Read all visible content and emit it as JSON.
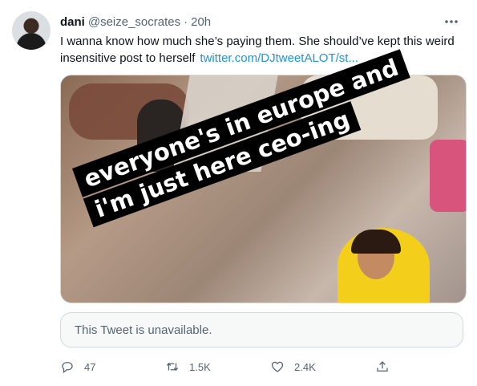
{
  "tweet": {
    "author_name": "dani",
    "author_handle": "@seize_socrates",
    "separator": "·",
    "time": "20h",
    "more_label": "•••",
    "text": "I wanna know how much she’s paying them. She should’ve kept this weird insensitive post to herself",
    "link_text": "twitter.com/DJtweetALOT/st...",
    "media": {
      "caption_lines": [
        "everyone's in europe and",
        "i'm just here ceo-ing"
      ]
    },
    "quoted": {
      "unavailable_text": "This Tweet is unavailable."
    },
    "actions": {
      "replies": "47",
      "retweets": "1.5K",
      "likes": "2.4K"
    }
  },
  "colors": {
    "text": "#0f1419",
    "secondary": "#536471",
    "link": "#1b95e0",
    "border": "#cfd9de"
  }
}
